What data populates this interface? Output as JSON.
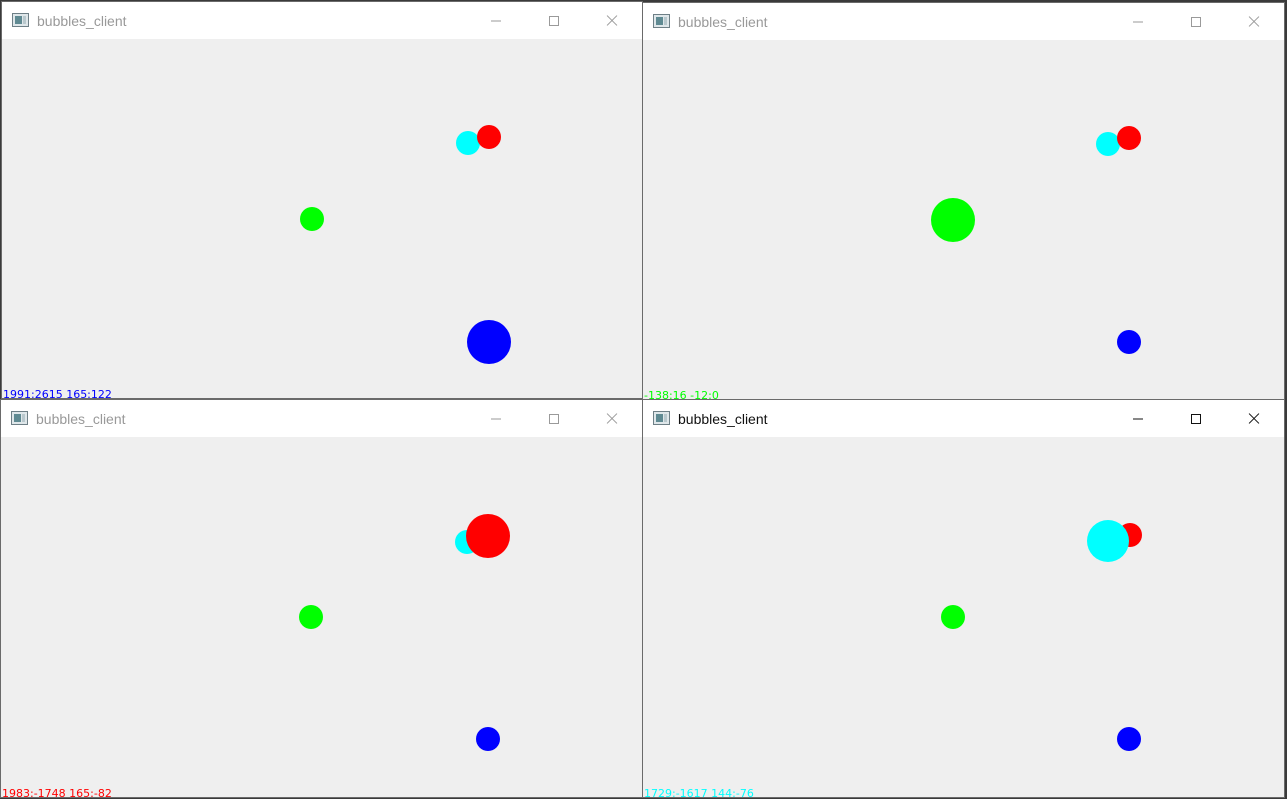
{
  "windows": [
    {
      "title": "bubbles_client",
      "active": false,
      "status_text": "1991:2615 165:122",
      "status_color": "#0000ff",
      "bubbles": [
        {
          "color": "#00ffff",
          "name": "cyan-bubble"
        },
        {
          "color": "#ff0000",
          "name": "red-bubble"
        },
        {
          "color": "#00ff00",
          "name": "green-bubble"
        },
        {
          "color": "#0000ff",
          "name": "blue-bubble"
        }
      ]
    },
    {
      "title": "bubbles_client",
      "active": false,
      "status_text": "-138:16 -12:0",
      "status_color": "#00ff00",
      "bubbles": [
        {
          "color": "#00ffff",
          "name": "cyan-bubble"
        },
        {
          "color": "#ff0000",
          "name": "red-bubble"
        },
        {
          "color": "#00ff00",
          "name": "green-bubble"
        },
        {
          "color": "#0000ff",
          "name": "blue-bubble"
        }
      ]
    },
    {
      "title": "bubbles_client",
      "active": false,
      "status_text": "1983:-1748 165:-82",
      "status_color": "#ff0000",
      "bubbles": [
        {
          "color": "#00ffff",
          "name": "cyan-bubble"
        },
        {
          "color": "#ff0000",
          "name": "red-bubble"
        },
        {
          "color": "#00ff00",
          "name": "green-bubble"
        },
        {
          "color": "#0000ff",
          "name": "blue-bubble"
        }
      ]
    },
    {
      "title": "bubbles_client",
      "active": true,
      "status_text": "1729:-1617 144:-76",
      "status_color": "#00ffff",
      "bubbles": [
        {
          "color": "#ff0000",
          "name": "red-bubble"
        },
        {
          "color": "#00ffff",
          "name": "cyan-bubble"
        },
        {
          "color": "#00ff00",
          "name": "green-bubble"
        },
        {
          "color": "#0000ff",
          "name": "blue-bubble"
        }
      ]
    }
  ],
  "icons": {
    "app": "app-window-icon",
    "minimize": "minimize-icon",
    "maximize": "maximize-icon",
    "close": "close-icon"
  }
}
